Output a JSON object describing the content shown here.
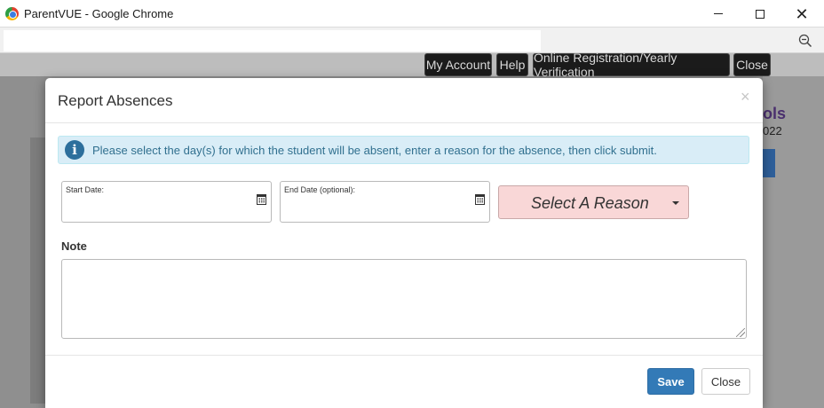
{
  "window": {
    "title": "ParentVUE - Google Chrome",
    "minimize_icon": "minimize-icon",
    "maximize_icon": "maximize-icon",
    "close_symbol": "✕"
  },
  "address_bar": {
    "url": "",
    "zoom_icon": "zoom-out-icon"
  },
  "top_nav": {
    "items": [
      {
        "label": "My Account"
      },
      {
        "label": "Help"
      },
      {
        "label": "Online Registration/Yearly Verification"
      },
      {
        "label": "Close"
      }
    ]
  },
  "background": {
    "side_heading": "ols",
    "side_subtext": "022"
  },
  "modal": {
    "title": "Report Absences",
    "close_symbol": "×",
    "info_text": "Please select the day(s) for which the student will be absent, enter a reason for the absence, then click submit.",
    "info_icon_glyph": "i",
    "start_date": {
      "label": "Start Date:",
      "value": ""
    },
    "end_date": {
      "label": "End Date (optional):",
      "value": ""
    },
    "reason": {
      "label": "Select A Reason"
    },
    "note": {
      "label": "Note",
      "value": ""
    },
    "footer": {
      "save_label": "Save",
      "close_label": "Close"
    }
  },
  "colors": {
    "primary": "#337ab7",
    "info_bg": "#d9edf7",
    "info_text": "#31708f",
    "reason_bg": "#f9d7d7",
    "nav_bg": "#1b1b1b"
  }
}
